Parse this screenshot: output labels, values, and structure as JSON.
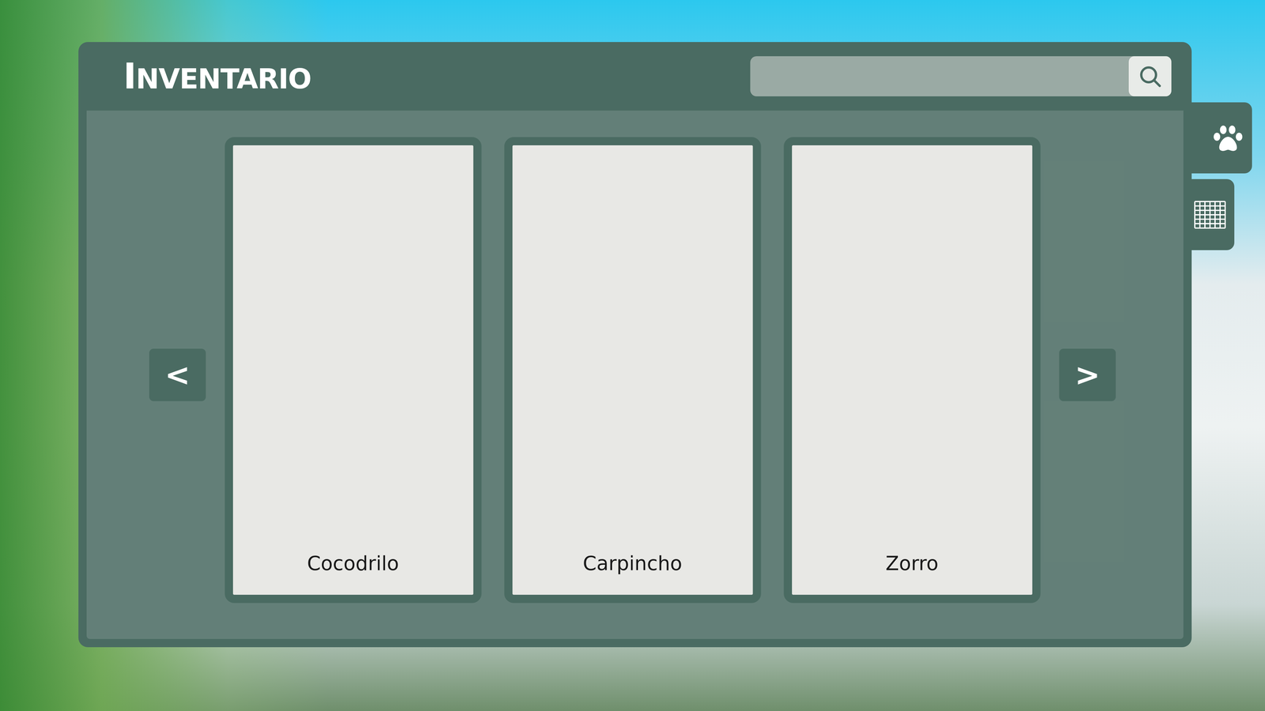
{
  "window": {
    "title": "INVENTARIO"
  },
  "navigation": {
    "previous": "<",
    "next": ">"
  },
  "cards": [
    {
      "name": "Cocodrilo"
    },
    {
      "name": "Carpincho"
    },
    {
      "name": "Zorro"
    }
  ],
  "side_tabs": [
    {
      "kind": "paw",
      "selected": true
    },
    {
      "kind": "grid",
      "selected": false
    }
  ]
}
